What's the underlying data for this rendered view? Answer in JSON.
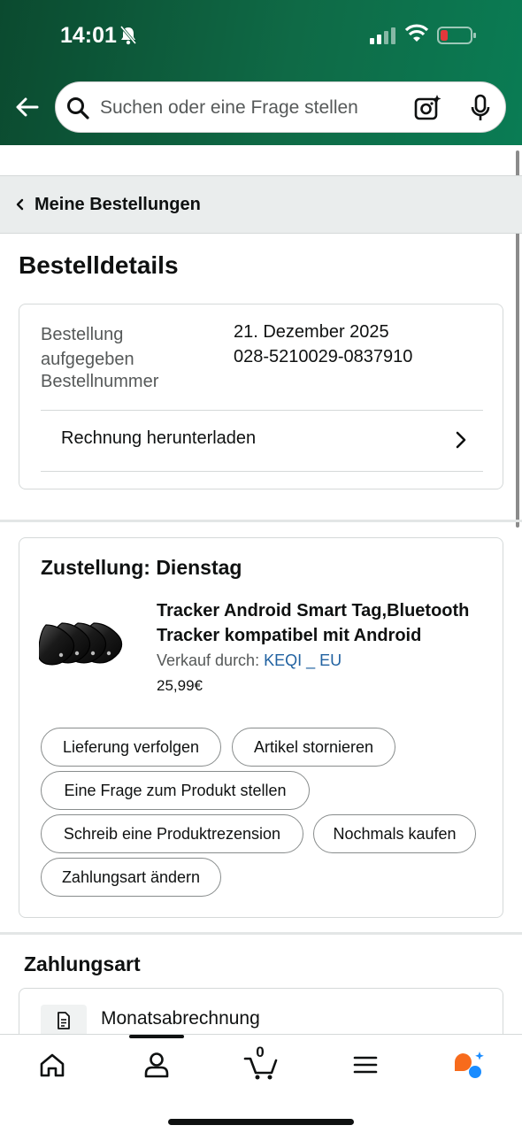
{
  "status_bar": {
    "time": "14:01"
  },
  "search": {
    "placeholder": "Suchen oder eine Frage stellen"
  },
  "breadcrumb": {
    "label": "Meine Bestellungen"
  },
  "page": {
    "title": "Bestelldetails"
  },
  "order": {
    "placed_label": "Bestellung aufgegeben",
    "placed_value": "21. Dezember 2025",
    "number_label": "Bestellnummer",
    "number_value": "028-5210029-0837910",
    "invoice_label": "Rechnung herunterladen"
  },
  "delivery": {
    "title": "Zustellung: Dienstag",
    "product_title": "Tracker Android Smart Tag,Bluetooth Tracker kompatibel mit Android",
    "seller_prefix": "Verkauf durch:",
    "seller_name": "KEQI _ EU",
    "price": "25,99€",
    "actions": {
      "track": "Lieferung verfolgen",
      "cancel": "Artikel stornieren",
      "question": "Eine Frage zum Produkt stellen",
      "review": "Schreib eine Produktrezension",
      "rebuy": "Nochmals kaufen",
      "change_payment": "Zahlungsart ändern"
    }
  },
  "payment": {
    "title": "Zahlungsart",
    "method": "Monatsabrechnung"
  },
  "tab_bar": {
    "cart_count": "0",
    "active_tab": "account"
  },
  "colors": {
    "header_start": "#0b4a2f",
    "header_end": "#0a7c54",
    "link": "#2162a1",
    "battery_low": "#e5383b",
    "assistant_orange": "#f76b1c",
    "assistant_blue": "#1a8cff"
  }
}
